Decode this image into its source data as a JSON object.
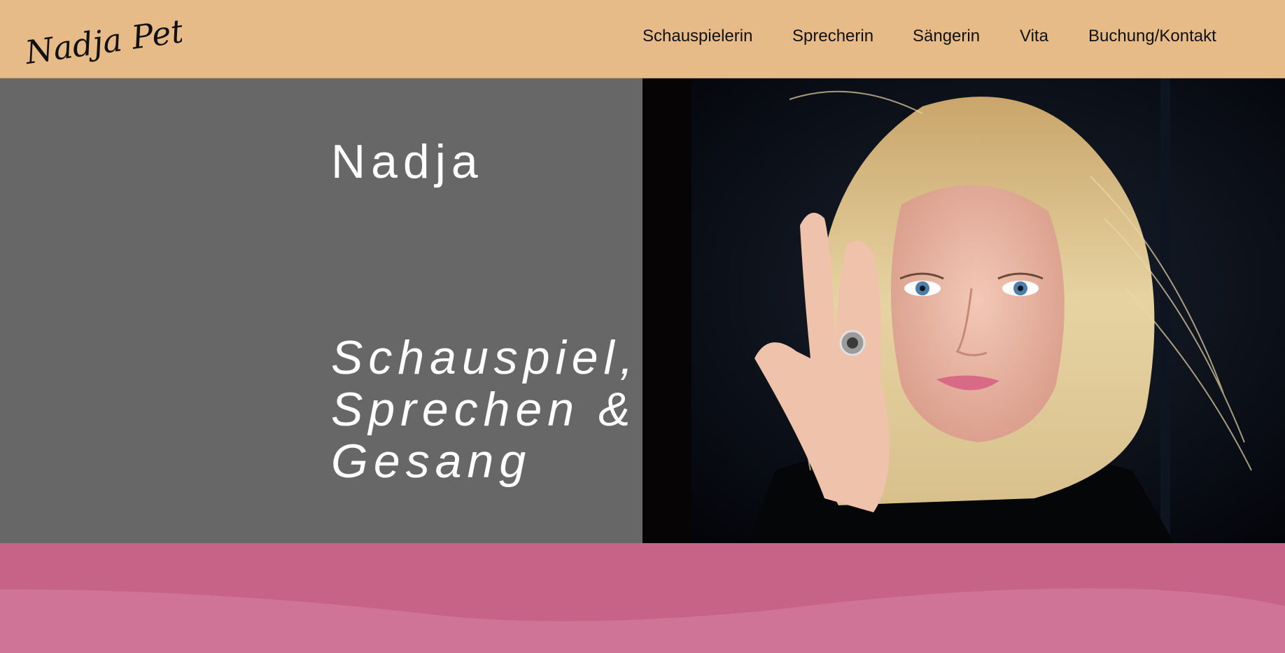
{
  "header": {
    "logo_text": "Nadja Petri",
    "nav": [
      {
        "label": "Schauspielerin"
      },
      {
        "label": "Sprecherin"
      },
      {
        "label": "Sängerin"
      },
      {
        "label": "Vita"
      },
      {
        "label": "Buchung/Kontakt"
      }
    ]
  },
  "hero": {
    "name": "Nadja",
    "tagline_lines": [
      "Schauspiel,",
      "Sprechen &",
      "Gesang"
    ],
    "photo_description_icon": "portrait-photo"
  },
  "colors": {
    "header_bg": "#e6bb88",
    "hero_left_bg": "#676767",
    "footer_bg": "#c66387",
    "footer_wave": "#cf7496"
  }
}
